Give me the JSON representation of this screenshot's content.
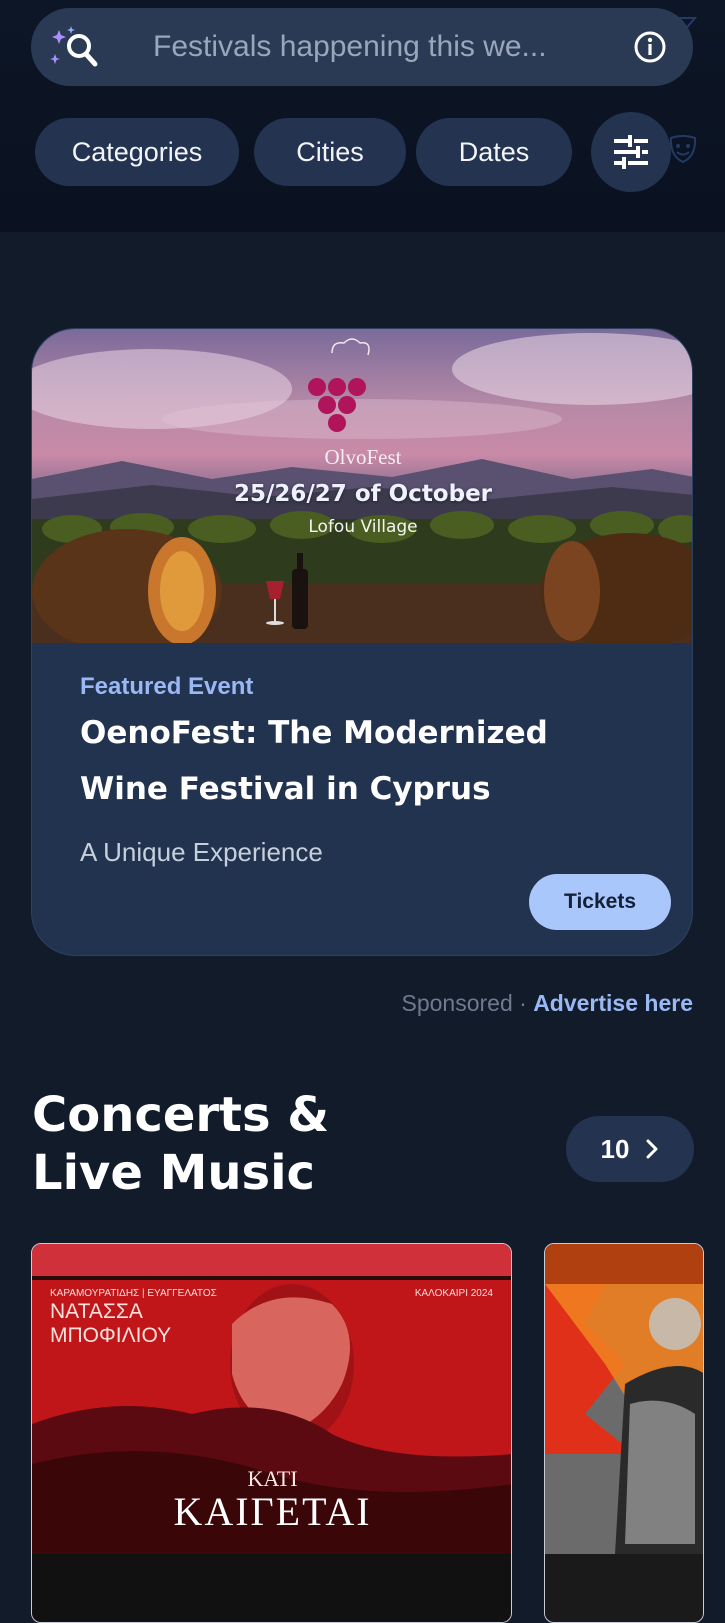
{
  "search": {
    "placeholder": "Festivals happening this we...",
    "icon": "search-sparkle-icon",
    "info_icon": "info-icon"
  },
  "filters": {
    "chips": [
      "Categories",
      "Cities",
      "Dates"
    ],
    "settings_icon": "tune-sliders-icon"
  },
  "featured": {
    "banner": {
      "logo_text": "OlvoFest",
      "dates": "25/26/27 of October",
      "place": "Lofou Village"
    },
    "label": "Featured Event",
    "title": "OenoFest: The Modernized Wine Festival in Cyprus",
    "subtitle": "A Unique Experience",
    "cta": "Tickets"
  },
  "sponsor": {
    "sponsored": "Sponsored",
    "separator": " · ",
    "advertise": "Advertise here"
  },
  "section": {
    "title": "Concerts & Live Music",
    "count": "10"
  },
  "posters": [
    {
      "top_left": "ΚΑΡΑΜΟΥΡΑΤΙΔΗΣ | ΕΥΑΓΓΕΛΑΤΟΣ",
      "top_right": "ΚΑΛΟΚΑΙΡΙ 2024",
      "artist": "ΝΑΤΑΣΣΑ ΜΠΟΦΙΛΙΟΥ",
      "line1": "ΚΑΤΙ",
      "line2": "ΚΑΙΓΕΤΑΙ"
    }
  ],
  "colors": {
    "background": "#121b2a",
    "card": "#223350",
    "chip": "#233350",
    "accent": "#9ab8f4",
    "button": "#a9c7fb"
  }
}
